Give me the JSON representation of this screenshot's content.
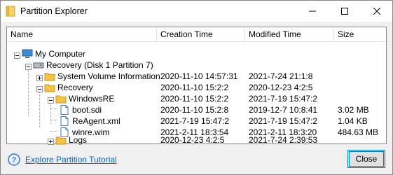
{
  "window": {
    "title": "Partition Explorer"
  },
  "columns": [
    "Name",
    "Creation Time",
    "Modified Time",
    "Size"
  ],
  "rows": [
    {
      "name": "My Computer",
      "created": "",
      "modified": "",
      "size": ""
    },
    {
      "name": "Recovery (Disk 1 Partition 7)",
      "created": "",
      "modified": "",
      "size": ""
    },
    {
      "name": "System Volume Information",
      "created": "2020-11-10 14:57:31",
      "modified": "2021-7-24 21:1:8",
      "size": ""
    },
    {
      "name": "Recovery",
      "created": "2020-11-10 15:2:2",
      "modified": "2020-12-23 4:2:5",
      "size": ""
    },
    {
      "name": "WindowsRE",
      "created": "2020-11-10 15:2:2",
      "modified": "2021-7-19 15:47:2",
      "size": ""
    },
    {
      "name": "boot.sdi",
      "created": "2020-11-10 15:2:8",
      "modified": "2019-12-7 10:8:41",
      "size": "3.02 MB"
    },
    {
      "name": "ReAgent.xml",
      "created": "2021-7-19 15:47:2",
      "modified": "2021-7-19 15:47:2",
      "size": "1.04 KB"
    },
    {
      "name": "winre.wim",
      "created": "2021-2-11 18:3:54",
      "modified": "2021-2-11 18:3:20",
      "size": "484.63 MB"
    },
    {
      "name": "Logs",
      "created": "2020-12-23 4:2:5",
      "modified": "2021-7-24 2:39:53",
      "size": ""
    }
  ],
  "footer": {
    "help_link": "Explore Partition Tutorial",
    "close_label": "Close"
  },
  "colors": {
    "folder": "#f5c542",
    "link": "#0066cc",
    "accent": "#0078d7"
  }
}
